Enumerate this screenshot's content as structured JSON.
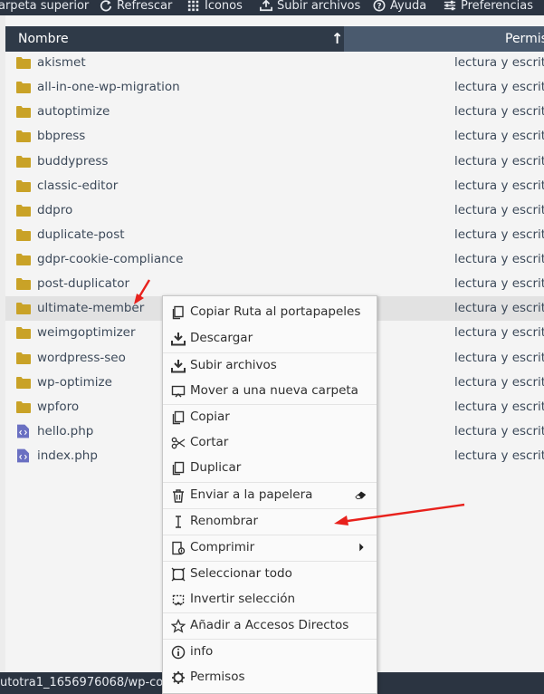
{
  "toolbar": {
    "items": [
      "arpeta superior",
      "Refrescar",
      "Iconos",
      "Subir archivos",
      "Ayuda",
      "Preferencias"
    ]
  },
  "header": {
    "name_col": "Nombre",
    "perms_col": "Permis",
    "sort_indicator": "↑"
  },
  "rows": [
    {
      "name": "akismet",
      "perm": "lectura y escrit",
      "type": "folder"
    },
    {
      "name": "all-in-one-wp-migration",
      "perm": "lectura y escrit",
      "type": "folder"
    },
    {
      "name": "autoptimize",
      "perm": "lectura y escrit",
      "type": "folder"
    },
    {
      "name": "bbpress",
      "perm": "lectura y escrit",
      "type": "folder"
    },
    {
      "name": "buddypress",
      "perm": "lectura y escrit",
      "type": "folder"
    },
    {
      "name": "classic-editor",
      "perm": "lectura y escrit",
      "type": "folder"
    },
    {
      "name": "ddpro",
      "perm": "lectura y escrit",
      "type": "folder"
    },
    {
      "name": "duplicate-post",
      "perm": "lectura y escrit",
      "type": "folder"
    },
    {
      "name": "gdpr-cookie-compliance",
      "perm": "lectura y escrit",
      "type": "folder"
    },
    {
      "name": "post-duplicator",
      "perm": "lectura y escrit",
      "type": "folder"
    },
    {
      "name": "ultimate-member",
      "perm": "lectura y escrit",
      "type": "folder"
    },
    {
      "name": "weimgoptimizer",
      "perm": "lectura y escrit",
      "type": "folder"
    },
    {
      "name": "wordpress-seo",
      "perm": "lectura y escrit",
      "type": "folder"
    },
    {
      "name": "wp-optimize",
      "perm": "lectura y escrit",
      "type": "folder"
    },
    {
      "name": "wpforo",
      "perm": "lectura y escrit",
      "type": "folder"
    },
    {
      "name": "hello.php",
      "perm": "lectura y escrit",
      "type": "php"
    },
    {
      "name": "index.php",
      "perm": "lectura y escrit",
      "type": "php"
    }
  ],
  "context_menu": {
    "items": [
      {
        "label": "Copiar Ruta al portapapeles",
        "icon": "copy-path-icon"
      },
      {
        "label": "Descargar",
        "icon": "download-icon"
      },
      {
        "label": "Subir archivos",
        "icon": "upload-icon"
      },
      {
        "label": "Mover a una nueva carpeta",
        "icon": "move-folder-icon"
      },
      {
        "label": "Copiar",
        "icon": "copy-icon"
      },
      {
        "label": "Cortar",
        "icon": "scissors-icon"
      },
      {
        "label": "Duplicar",
        "icon": "duplicate-icon"
      },
      {
        "label": "Enviar a la papelera",
        "icon": "trash-icon"
      },
      {
        "label": "Renombrar",
        "icon": "text-cursor-icon"
      },
      {
        "label": "Comprimir",
        "icon": "compress-icon"
      },
      {
        "label": "Seleccionar todo",
        "icon": "select-all-icon"
      },
      {
        "label": "Invertir selección",
        "icon": "invert-selection-icon"
      },
      {
        "label": "Añadir a Accesos Directos",
        "icon": "star-icon"
      },
      {
        "label": "info",
        "icon": "info-icon"
      },
      {
        "label": "Permisos",
        "icon": "gear-icon"
      }
    ]
  },
  "status_bar": {
    "path": "utotra1_1656976068/wp-co"
  },
  "colors": {
    "toolbar_bg": "#2b3441",
    "header_bg": "#2f3a48",
    "folder": "#c9a227",
    "php_icon": "#6a70c2",
    "annotation_arrow": "#e8211c"
  }
}
